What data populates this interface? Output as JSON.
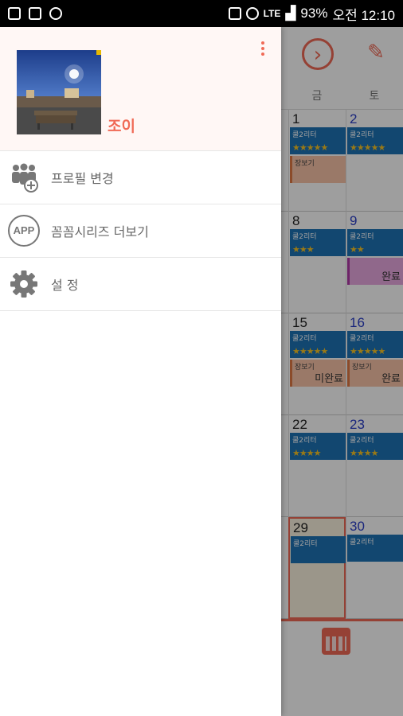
{
  "status_bar": {
    "battery": "93%",
    "time": "오전 12:10",
    "network": "LTE"
  },
  "calendar": {
    "day_names": [
      "금",
      "토"
    ],
    "weeks": [
      {
        "fri": "1",
        "sat": "2"
      },
      {
        "fri": "8",
        "sat": "9"
      },
      {
        "fri": "15",
        "sat": "16"
      },
      {
        "fri": "22",
        "sat": "23"
      },
      {
        "fri": "29",
        "sat": "30"
      }
    ],
    "event_label": "쿨2리터",
    "event_label_2": "장보기",
    "status_done": "완료",
    "status_undone": "미완료",
    "stars_5": "★★★★★",
    "stars_3": "★★★",
    "stars_4": "★★★★",
    "stars_2": "★★"
  },
  "drawer": {
    "username": "조이",
    "menu": [
      {
        "label": "프로필 변경",
        "icon": "profile-change-icon"
      },
      {
        "label": "꼼꼼시리즈 더보기",
        "icon": "app-icon"
      },
      {
        "label": "설 정",
        "icon": "gear-icon"
      }
    ],
    "app_badge": "APP"
  },
  "colors": {
    "accent": "#f06a56",
    "event_blue": "#1e73b5",
    "saturday": "#2a3ec8"
  }
}
